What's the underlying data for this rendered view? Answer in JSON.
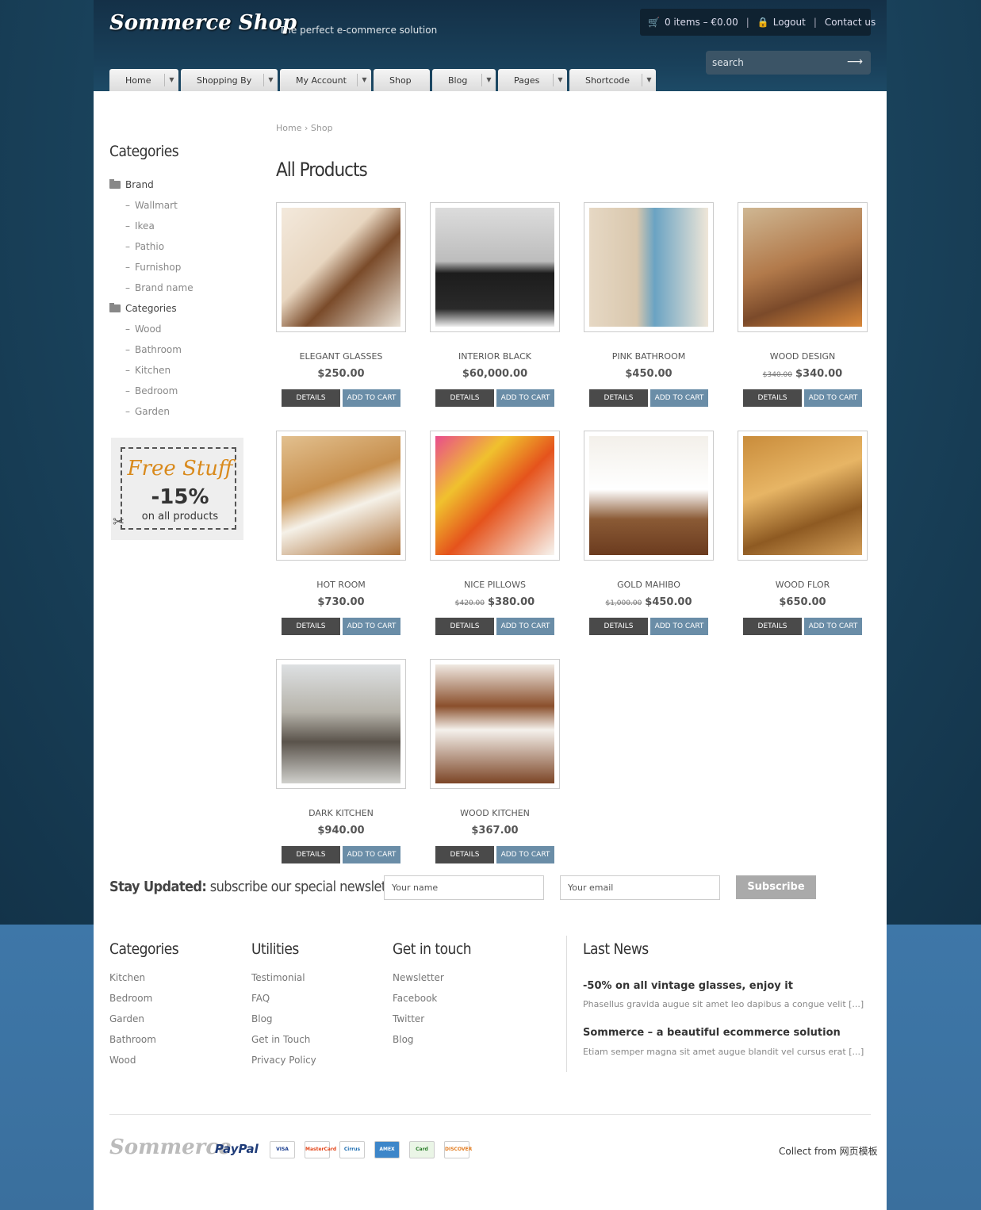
{
  "header": {
    "logo": "Sommerce Shop",
    "tagline": "The perfect e-commerce solution",
    "cart": "0 items – €0.00",
    "logout": "Logout",
    "contact": "Contact us",
    "search_placeholder": "search"
  },
  "nav": [
    {
      "label": "Home",
      "dropdown": true
    },
    {
      "label": "Shopping By",
      "dropdown": true
    },
    {
      "label": "My Account",
      "dropdown": true
    },
    {
      "label": "Shop",
      "dropdown": false
    },
    {
      "label": "Blog",
      "dropdown": true
    },
    {
      "label": "Pages",
      "dropdown": true
    },
    {
      "label": "Shortcode",
      "dropdown": true
    }
  ],
  "sidebar": {
    "title": "Categories",
    "groups": [
      {
        "label": "Brand",
        "items": [
          "Wallmart",
          "Ikea",
          "Pathio",
          "Furnishop",
          "Brand name"
        ]
      },
      {
        "label": "Categories",
        "items": [
          "Wood",
          "Bathroom",
          "Kitchen",
          "Bedroom",
          "Garden"
        ]
      }
    ],
    "promo": {
      "line1": "Free Stuff",
      "line2": "-15%",
      "line3": "on all products"
    }
  },
  "breadcrumb": {
    "home": "Home",
    "sep": "›",
    "current": "Shop"
  },
  "page_title": "All Products",
  "buttons": {
    "details": "DETAILS",
    "add": "ADD TO CART"
  },
  "products": [
    {
      "name": "ELEGANT GLASSES",
      "price": "$250.00",
      "old": ""
    },
    {
      "name": "INTERIOR BLACK",
      "price": "$60,000.00",
      "old": ""
    },
    {
      "name": "PINK BATHROOM",
      "price": "$450.00",
      "old": ""
    },
    {
      "name": "WOOD DESIGN",
      "price": "$340.00",
      "old": "$340.00"
    },
    {
      "name": "HOT ROOM",
      "price": "$730.00",
      "old": ""
    },
    {
      "name": "NICE PILLOWS",
      "price": "$380.00",
      "old": "$420.00"
    },
    {
      "name": "GOLD MAHIBO",
      "price": "$450.00",
      "old": "$1,000.00"
    },
    {
      "name": "WOOD FLOR",
      "price": "$650.00",
      "old": ""
    },
    {
      "name": "DARK KITCHEN",
      "price": "$940.00",
      "old": ""
    },
    {
      "name": "WOOD KITCHEN",
      "price": "$367.00",
      "old": ""
    }
  ],
  "newsletter": {
    "title_bold": "Stay Updated:",
    "title_rest": " subscribe our special newsletter",
    "name_placeholder": "Your name",
    "email_placeholder": "Your email",
    "button": "Subscribe"
  },
  "footer": {
    "categories": {
      "title": "Categories",
      "items": [
        "Kitchen",
        "Bedroom",
        "Garden",
        "Bathroom",
        "Wood"
      ]
    },
    "utilities": {
      "title": "Utilities",
      "items": [
        "Testimonial",
        "FAQ",
        "Blog",
        "Get in Touch",
        "Privacy Policy"
      ]
    },
    "touch": {
      "title": "Get in touch",
      "items": [
        "Newsletter",
        "Facebook",
        "Twitter",
        "Blog"
      ]
    },
    "news": {
      "title": "Last News",
      "items": [
        {
          "title": "-50% on all vintage glasses, enjoy it",
          "excerpt": "Phasellus gravida augue sit amet leo dapibus a congue velit [...]"
        },
        {
          "title": "Sommerce – a beautiful ecommerce solution",
          "excerpt": "Etiam semper magna sit amet augue blandit vel cursus erat [...]"
        }
      ]
    },
    "logo": "Sommerce",
    "paypal": "PayPal",
    "cards": [
      "VISA",
      "MasterCard",
      "Cirrus",
      "AMEX",
      "Card",
      "DISCOVER"
    ],
    "collect": "Collect from 网页模板"
  }
}
